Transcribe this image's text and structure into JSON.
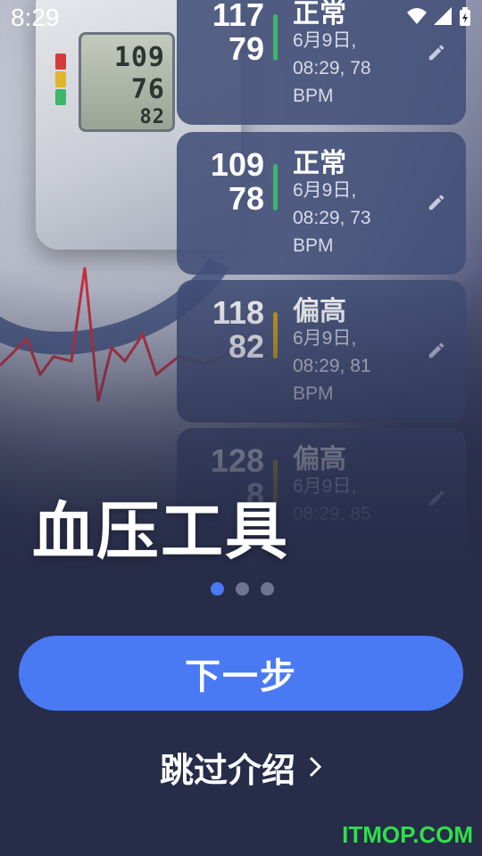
{
  "status_bar": {
    "time": "8:29",
    "icons": [
      "wifi-icon",
      "signal-icon",
      "battery-icon"
    ]
  },
  "records": [
    {
      "systolic": "117",
      "diastolic": "79",
      "status": "正常",
      "detail": "6月9日, 08:29, 78 BPM",
      "color": "#3fb56a"
    },
    {
      "systolic": "109",
      "diastolic": "78",
      "status": "正常",
      "detail": "6月9日, 08:29, 73 BPM",
      "color": "#3fb56a"
    },
    {
      "systolic": "118",
      "diastolic": "82",
      "status": "偏高",
      "detail": "6月9日, 08:29, 81 BPM",
      "color": "#c9a21c"
    },
    {
      "systolic": "128",
      "diastolic": "8",
      "status": "偏高",
      "detail": "6月9日, 08:29, 85",
      "color": "#c9a21c"
    }
  ],
  "headline": "血压工具",
  "subline": "",
  "pager": {
    "count": 3,
    "active": 0
  },
  "next_button": "下一步",
  "skip_button": "跳过介绍",
  "watermark": "ITMOP.COM",
  "colors": {
    "background": "#272c48",
    "accent": "#4a79f4",
    "normal": "#3fb56a",
    "elevated": "#c9a21c",
    "watermark": "#2ee04a"
  }
}
